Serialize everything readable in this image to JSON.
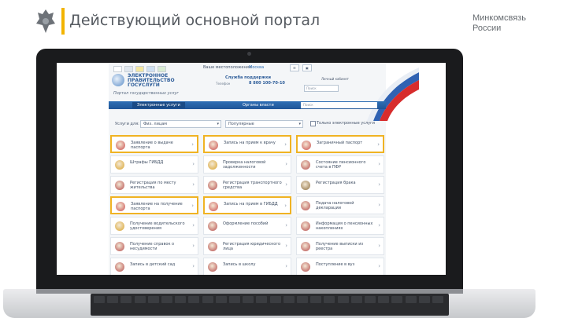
{
  "slide": {
    "title": "Действующий основной портал",
    "ministry": [
      "Минкомсвязь",
      "России"
    ]
  },
  "portal": {
    "name": "ЭЛЕКТРОННОЕ ПРАВИТЕЛЬСТВО ГОСУСЛУГИ",
    "tagline": "Портал государственных услуг",
    "location_text": "Ваше местоположение:",
    "location_link": "Москва",
    "help_label": "Служба поддержки",
    "phone_label": "Телефон",
    "phone_number": "8 800 100-70-10",
    "user_label": "Личный кабинет",
    "header_search_placeholder": "Поиск",
    "nav_tabs": [
      "Электронные услуги",
      "Органы власти"
    ],
    "nav_search_placeholder": "Поиск",
    "filters": {
      "prefix": "Услуги для:",
      "audience": "Физ. лицам",
      "category": "Популярные",
      "checkbox_label": "Только электронные услуги"
    },
    "tiles": [
      {
        "label": "Заявление о выдаче паспорта",
        "color": "#c94a4a"
      },
      {
        "label": "Запись на прием к врачу",
        "color": "#c94a4a"
      },
      {
        "label": "Заграничный паспорт",
        "color": "#c94a4a"
      },
      {
        "label": "Штрафы ГИБДД",
        "color": "#d8a22a"
      },
      {
        "label": "Проверка налоговой задолженности",
        "color": "#d8a22a"
      },
      {
        "label": "Состояние пенсионного счета в ПФР",
        "color": "#b44848"
      },
      {
        "label": "Регистрация по месту жительства",
        "color": "#b44848"
      },
      {
        "label": "Регистрация транспортного средства",
        "color": "#b44848"
      },
      {
        "label": "Регистрация брака",
        "color": "#8a6a3a"
      },
      {
        "label": "Заявление на получение паспорта",
        "color": "#c94a4a"
      },
      {
        "label": "Запись на прием в ГИБДД",
        "color": "#c94a4a"
      },
      {
        "label": "Подача налоговой декларации",
        "color": "#b44848"
      },
      {
        "label": "Получение водительского удостоверения",
        "color": "#d8a22a"
      },
      {
        "label": "Оформление пособий",
        "color": "#b44848"
      },
      {
        "label": "Информация о пенсионных накоплениях",
        "color": "#b44848"
      },
      {
        "label": "Получение справок о несудимости",
        "color": "#b44848"
      },
      {
        "label": "Регистрация юридического лица",
        "color": "#b44848"
      },
      {
        "label": "Получение выписки из реестра",
        "color": "#b44848"
      },
      {
        "label": "Запись в детский сад",
        "color": "#b44848"
      },
      {
        "label": "Запись в школу",
        "color": "#b44848"
      },
      {
        "label": "Поступление в вуз",
        "color": "#b44848"
      }
    ]
  }
}
